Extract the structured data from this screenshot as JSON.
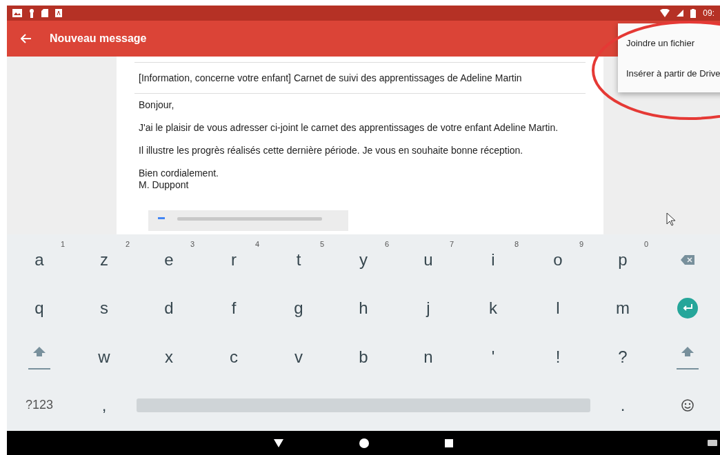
{
  "status_bar": {
    "time": "09:"
  },
  "app_bar": {
    "title": "Nouveau message"
  },
  "menu": {
    "items": [
      "Joindre un fichier",
      "Insérer à partir de Drive"
    ]
  },
  "message": {
    "subject": "[Information, concerne votre enfant] Carnet de suivi des apprentissages de Adeline Martin",
    "paragraphs": [
      [
        "Bonjour,"
      ],
      [
        "J'ai le plaisir de vous adresser ci-joint le carnet des apprentissages de votre enfant Adeline Martin."
      ],
      [
        "Il illustre les progrès réalisés cette dernière période. Je vous en souhaite bonne réception."
      ],
      [
        "Bien cordialement.",
        "M. Duppont"
      ]
    ]
  },
  "keyboard": {
    "rows": [
      [
        {
          "kind": "letter",
          "label": "a",
          "hint": "1"
        },
        {
          "kind": "letter",
          "label": "z",
          "hint": "2"
        },
        {
          "kind": "letter",
          "label": "e",
          "hint": "3"
        },
        {
          "kind": "letter",
          "label": "r",
          "hint": "4"
        },
        {
          "kind": "letter",
          "label": "t",
          "hint": "5"
        },
        {
          "kind": "letter",
          "label": "y",
          "hint": "6"
        },
        {
          "kind": "letter",
          "label": "u",
          "hint": "7"
        },
        {
          "kind": "letter",
          "label": "i",
          "hint": "8"
        },
        {
          "kind": "letter",
          "label": "o",
          "hint": "9"
        },
        {
          "kind": "letter",
          "label": "p",
          "hint": "0"
        },
        {
          "kind": "backspace"
        }
      ],
      [
        {
          "kind": "letter",
          "label": "q"
        },
        {
          "kind": "letter",
          "label": "s"
        },
        {
          "kind": "letter",
          "label": "d"
        },
        {
          "kind": "letter",
          "label": "f"
        },
        {
          "kind": "letter",
          "label": "g"
        },
        {
          "kind": "letter",
          "label": "h"
        },
        {
          "kind": "letter",
          "label": "j"
        },
        {
          "kind": "letter",
          "label": "k"
        },
        {
          "kind": "letter",
          "label": "l"
        },
        {
          "kind": "letter",
          "label": "m"
        },
        {
          "kind": "enter"
        }
      ],
      [
        {
          "kind": "shift"
        },
        {
          "kind": "letter",
          "label": "w"
        },
        {
          "kind": "letter",
          "label": "x"
        },
        {
          "kind": "letter",
          "label": "c"
        },
        {
          "kind": "letter",
          "label": "v"
        },
        {
          "kind": "letter",
          "label": "b"
        },
        {
          "kind": "letter",
          "label": "n"
        },
        {
          "kind": "letter",
          "label": "'"
        },
        {
          "kind": "letter",
          "label": "!"
        },
        {
          "kind": "letter",
          "label": "?"
        },
        {
          "kind": "shift"
        }
      ]
    ],
    "bottom_row": [
      {
        "kind": "symbols",
        "label": "?123"
      },
      {
        "kind": "letter",
        "label": ","
      },
      {
        "kind": "space"
      },
      {
        "kind": "letter",
        "label": "."
      },
      {
        "kind": "emoji"
      }
    ]
  }
}
